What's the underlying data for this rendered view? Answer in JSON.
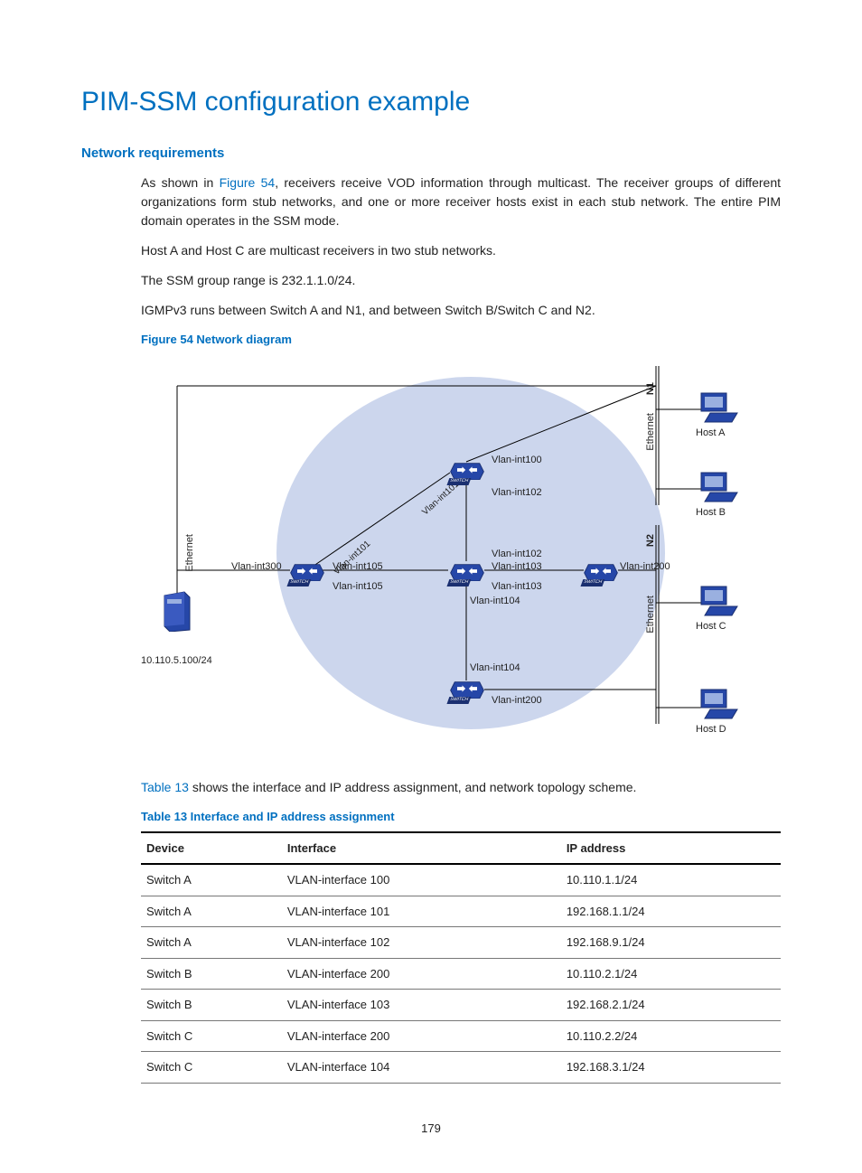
{
  "h1": "PIM-SSM configuration example",
  "h2_net_req": "Network requirements",
  "para1_a": "As shown in ",
  "para1_link": "Figure 54",
  "para1_b": ", receivers receive VOD information through multicast. The receiver groups of different organizations form stub networks, and one or more receiver hosts exist in each stub network. The entire PIM domain operates in the SSM mode.",
  "para2": "Host A and Host C are multicast receivers in two stub networks.",
  "para3": "The SSM group range is 232.1.1.0/24.",
  "para4": "IGMPv3 runs between Switch A and N1, and between Switch B/Switch C and N2.",
  "fig_caption": "Figure 54 Network diagram",
  "para5_link": "Table 13",
  "para5_a": " shows the interface and IP address assignment, and network topology scheme.",
  "tbl_caption": "Table 13 Interface and IP address assignment",
  "tbl_h1": "Device",
  "tbl_h2": "Interface",
  "tbl_h3": "IP address",
  "rows": [
    {
      "d": "Switch A",
      "i": "VLAN-interface 100",
      "a": "10.110.1.1/24"
    },
    {
      "d": "Switch A",
      "i": "VLAN-interface 101",
      "a": "192.168.1.1/24"
    },
    {
      "d": "Switch A",
      "i": "VLAN-interface 102",
      "a": "192.168.9.1/24"
    },
    {
      "d": "Switch B",
      "i": "VLAN-interface 200",
      "a": "10.110.2.1/24"
    },
    {
      "d": "Switch B",
      "i": "VLAN-interface 103",
      "a": "192.168.2.1/24"
    },
    {
      "d": "Switch C",
      "i": "VLAN-interface 200",
      "a": "10.110.2.2/24"
    },
    {
      "d": "Switch C",
      "i": "VLAN-interface 104",
      "a": "192.168.3.1/24"
    }
  ],
  "diagram": {
    "vlan_int100": "Vlan-int100",
    "vlan_int101_a": "Vlan-int101",
    "vlan_int101_b": "Vlan-int101",
    "vlan_int102_a": "Vlan-int102",
    "vlan_int102_b": "Vlan-int102",
    "vlan_int103_a": "Vlan-int103",
    "vlan_int103_b": "Vlan-int103",
    "vlan_int104_a": "Vlan-int104",
    "vlan_int104_b": "Vlan-int104",
    "vlan_int105_a": "Vlan-int105",
    "vlan_int105_b": "Vlan-int105",
    "vlan_int200_a": "Vlan-int200",
    "vlan_int200_b": "Vlan-int200",
    "vlan_int300": "Vlan-int300",
    "ethernet": "Ethernet",
    "n1": "N1",
    "n2": "N2",
    "host_a": "Host A",
    "host_b": "Host B",
    "host_c": "Host C",
    "host_d": "Host D",
    "src_ip": "10.110.5.100/24"
  },
  "page_num": "179"
}
